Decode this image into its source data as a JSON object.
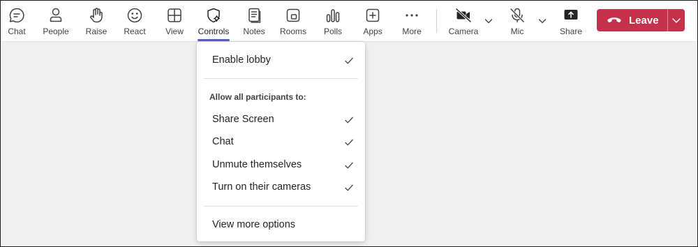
{
  "toolbar": {
    "items": [
      {
        "id": "chat",
        "label": "Chat",
        "icon": "chat-icon"
      },
      {
        "id": "people",
        "label": "People",
        "icon": "people-icon"
      },
      {
        "id": "raise",
        "label": "Raise",
        "icon": "raise-hand-icon"
      },
      {
        "id": "react",
        "label": "React",
        "icon": "smiley-icon"
      },
      {
        "id": "view",
        "label": "View",
        "icon": "grid-view-icon"
      },
      {
        "id": "controls",
        "label": "Controls",
        "icon": "shield-settings-icon",
        "active": true
      },
      {
        "id": "notes",
        "label": "Notes",
        "icon": "notes-icon"
      },
      {
        "id": "rooms",
        "label": "Rooms",
        "icon": "rooms-icon"
      },
      {
        "id": "polls",
        "label": "Polls",
        "icon": "polls-icon"
      },
      {
        "id": "apps",
        "label": "Apps",
        "icon": "add-square-icon"
      },
      {
        "id": "more",
        "label": "More",
        "icon": "more-horizontal-icon"
      },
      {
        "id": "camera",
        "label": "Camera",
        "icon": "camera-off-icon"
      },
      {
        "id": "mic",
        "label": "Mic",
        "icon": "mic-off-icon"
      },
      {
        "id": "share",
        "label": "Share",
        "icon": "share-screen-icon"
      }
    ],
    "leave": {
      "label": "Leave",
      "icon": "phone-hangup-icon"
    },
    "accent_color": "#5b5fc7",
    "leave_color": "#c4314b"
  },
  "controls_menu": {
    "enable_lobby": {
      "label": "Enable lobby",
      "checked": true
    },
    "section_heading": "Allow all participants to:",
    "options": [
      {
        "label": "Share Screen",
        "checked": true
      },
      {
        "label": "Chat",
        "checked": true
      },
      {
        "label": "Unmute themselves",
        "checked": true
      },
      {
        "label": "Turn on their cameras",
        "checked": true
      }
    ],
    "view_more": "View more options"
  }
}
